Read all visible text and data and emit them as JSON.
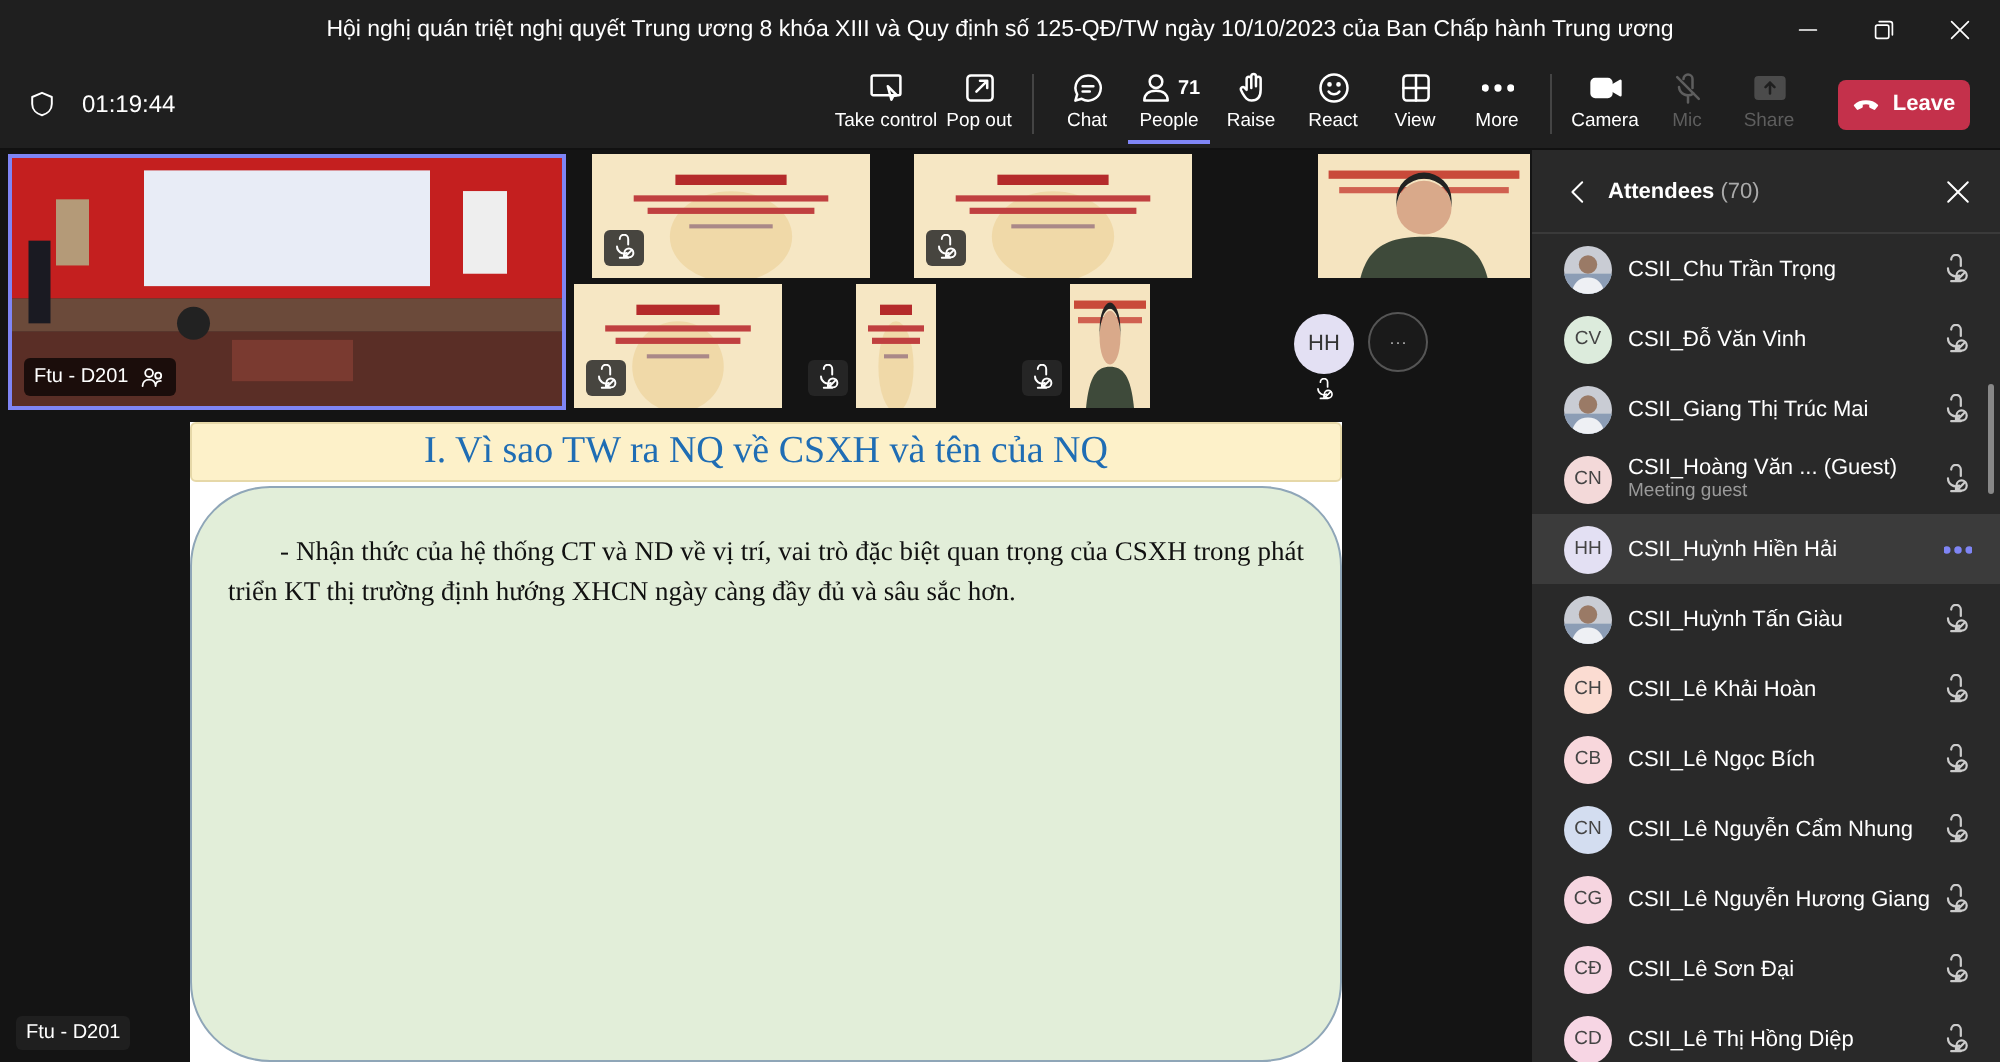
{
  "window": {
    "title": "Hội nghị quán triệt nghị quyết Trung ương 8 khóa XIII và Quy định số 125-QĐ/TW ngày 10/10/2023 của Ban Chấp hành Trung ương"
  },
  "toolbar": {
    "timer": "01:19:44",
    "items": [
      {
        "kind": "take-control",
        "label": "Take control",
        "selected": false,
        "disabled": false
      },
      {
        "kind": "pop-out",
        "label": "Pop out",
        "selected": false,
        "disabled": false
      },
      {
        "kind": "chat",
        "label": "Chat",
        "selected": false,
        "disabled": false
      },
      {
        "kind": "people",
        "label": "People",
        "count": "71",
        "selected": true,
        "disabled": false
      },
      {
        "kind": "raise",
        "label": "Raise",
        "selected": false,
        "disabled": false
      },
      {
        "kind": "react",
        "label": "React",
        "selected": false,
        "disabled": false
      },
      {
        "kind": "view",
        "label": "View",
        "selected": false,
        "disabled": false
      },
      {
        "kind": "more",
        "label": "More",
        "selected": false,
        "disabled": false
      },
      {
        "kind": "camera",
        "label": "Camera",
        "selected": false,
        "disabled": false
      },
      {
        "kind": "mic",
        "label": "Mic",
        "selected": false,
        "disabled": true
      },
      {
        "kind": "share",
        "label": "Share",
        "selected": false,
        "disabled": true
      }
    ],
    "leave": "Leave"
  },
  "stage": {
    "main_tile": {
      "kind": "room",
      "label": "Ftu - D201",
      "selected": true
    },
    "top_row": [
      {
        "kind": "slide",
        "muted": true
      },
      {
        "kind": "slide",
        "muted": true
      },
      {
        "kind": "person"
      }
    ],
    "bottom_row": [
      {
        "kind": "slide",
        "muted": true
      },
      {
        "kind": "slide-narrow",
        "muted": true
      },
      {
        "kind": "person-narrow",
        "muted": true
      },
      {
        "kind": "avatar",
        "initials": "HH",
        "muted": true
      },
      {
        "kind": "overflow",
        "label": "···"
      }
    ],
    "slide": {
      "title": "I. Vì sao TW ra NQ về CSXH và tên của NQ",
      "body": "- Nhận thức của hệ thống CT và ND về vị trí, vai trò đặc biệt quan trọng của CSXH trong phát triển KT thị trường định hướng XHCN ngày càng đầy đủ và sâu sắc hơn."
    },
    "presenter_label": "Ftu - D201"
  },
  "attendees": {
    "title": "Attendees",
    "count": "(70)",
    "people": [
      {
        "name": "CSII_Chu Trần Trọng",
        "selected": false,
        "muted": true
      },
      {
        "kind": "initials",
        "initials": "CV",
        "color": "#dcebdc",
        "name": "CSII_Đỗ Văn Vinh",
        "selected": false,
        "muted": true
      },
      {
        "name": "CSII_Giang Thị Trúc Mai",
        "selected": false,
        "muted": true
      },
      {
        "kind": "initials",
        "initials": "CN",
        "color": "#f3d9d9",
        "name": "CSII_Hoàng Văn ... (Guest)",
        "subtitle": "Meeting guest",
        "selected": false,
        "muted": true
      },
      {
        "kind": "initials",
        "initials": "HH",
        "color": "#e3e0f3",
        "name": "CSII_Huỳnh Hiền Hải",
        "selected": true
      },
      {
        "name": "CSII_Huỳnh Tấn Giàu",
        "selected": false,
        "muted": true
      },
      {
        "kind": "initials",
        "initials": "CH",
        "color": "#fbdcd2",
        "name": "CSII_Lê Khải Hoàn",
        "selected": false,
        "muted": true
      },
      {
        "kind": "initials",
        "initials": "CB",
        "color": "#f8d7dc",
        "name": "CSII_Lê Ngọc Bích",
        "selected": false,
        "muted": true
      },
      {
        "kind": "initials",
        "initials": "CN",
        "color": "#d3ddf0",
        "name": "CSII_Lê Nguyễn Cẩm Nhung",
        "selected": false,
        "muted": true
      },
      {
        "kind": "initials",
        "initials": "CG",
        "color": "#f6d5e0",
        "name": "CSII_Lê Nguyễn Hương Giang",
        "selected": false,
        "muted": true
      },
      {
        "kind": "initials",
        "initials": "CĐ",
        "color": "#f6d5e2",
        "name": "CSII_Lê Sơn Đại",
        "selected": false,
        "muted": true
      },
      {
        "kind": "initials",
        "initials": "CD",
        "color": "#f7d6e4",
        "name": "CSII_Lê Thị Hồng Diệp",
        "selected": false,
        "muted": true
      }
    ]
  }
}
